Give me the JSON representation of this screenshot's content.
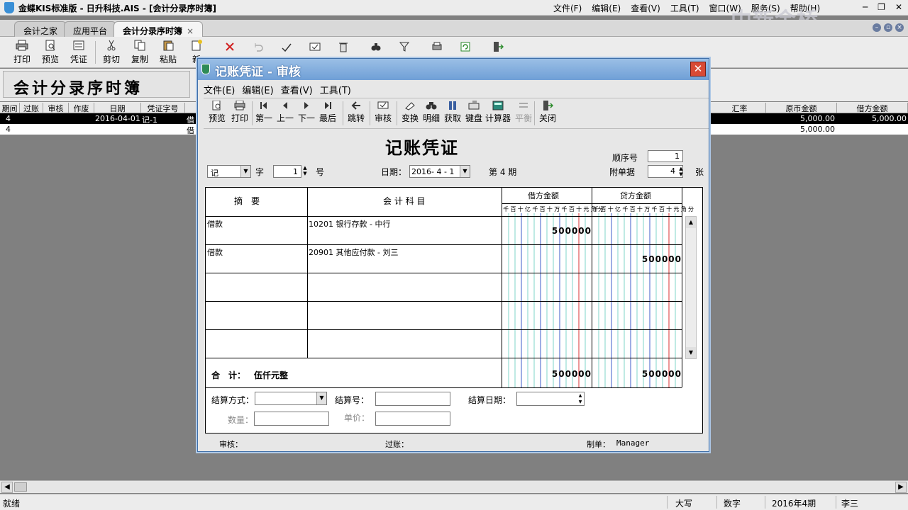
{
  "app": {
    "title": "金蝶KIS标准版 - 日升科技.AIS - [会计分录序时簿]",
    "menu": [
      "文件(F)",
      "编辑(E)",
      "查看(V)",
      "工具(T)",
      "窗口(W)",
      "服务(S)",
      "帮助(H)"
    ],
    "watermark": "中新金桥",
    "win_min": "─",
    "win_restore": "❐",
    "win_close": "✕"
  },
  "tabs": [
    {
      "label": "会计之家"
    },
    {
      "label": "应用平台"
    },
    {
      "label": "会计分录序时簿",
      "close": "×"
    }
  ],
  "toolbar": {
    "print": "打印",
    "preview": "预览",
    "voucher": "凭证",
    "cut": "剪切",
    "copy": "复制",
    "paste": "粘贴",
    "new": "新"
  },
  "page_title": "会计分录序时簿",
  "grid": {
    "headers": [
      "期间",
      "过账",
      "审核",
      "作废",
      "日期",
      "凭证字号",
      "",
      "汇率",
      "原币金额",
      "借方金额"
    ],
    "rows": [
      {
        "period": "4",
        "date": "2016-04-01",
        "voucher_no": "记-1",
        "summary": "借",
        "original": "5,000.00",
        "debit": "5,000.00"
      },
      {
        "period": "4",
        "summary": "借",
        "original": "5,000.00",
        "debit": ""
      }
    ]
  },
  "statusbar": {
    "ready": "就绪",
    "caps": "大写",
    "num": "数字",
    "period": "2016年4期",
    "user": "李三"
  },
  "dialog": {
    "title": "记账凭证 - 审核",
    "close": "✕",
    "menu": [
      "文件(E)",
      "编辑(E)",
      "查看(V)",
      "工具(T)"
    ],
    "toolbar": {
      "preview": "预览",
      "print": "打印",
      "first": "第一",
      "prev": "上一",
      "next": "下一",
      "last": "最后",
      "jump": "跳转",
      "audit": "审核",
      "transform": "变换",
      "detail": "明细",
      "fetch": "获取",
      "keyboard": "键盘",
      "calculator": "计算器",
      "balance": "平衡",
      "close": "关闭"
    },
    "voucher_title": "记账凭证",
    "seq_label": "顺序号",
    "seq_value": "1",
    "attach_label": "附单据",
    "attach_value": "4",
    "attach_unit": "张",
    "word_value": "记",
    "word_label": "字",
    "number_value": "1",
    "number_label": "号",
    "date_label": "日期：",
    "date_value": "2016- 4 - 1",
    "period_text": "第 4 期",
    "table": {
      "summary_header": "摘　要",
      "account_header": "会 计 科 目",
      "debit_header": "借方金额",
      "credit_header": "贷方金额",
      "digits": [
        "千",
        "百",
        "十",
        "亿",
        "千",
        "百",
        "十",
        "万",
        "千",
        "百",
        "十",
        "元",
        "角",
        "分"
      ],
      "entries": [
        {
          "summary": "借款",
          "account": "10201 银行存款 - 中行",
          "debit": "500000",
          "credit": ""
        },
        {
          "summary": "借款",
          "account": "20901 其他应付款 - 刘三",
          "debit": "",
          "credit": "500000"
        }
      ],
      "total_label": "合　计：",
      "total_words": "伍仟元整",
      "total_debit": "500000",
      "total_credit": "500000"
    },
    "settle_method_label": "结算方式：",
    "settle_no_label": "结算号：",
    "settle_date_label": "结算日期：",
    "qty_label": "数量：",
    "price_label": "单价：",
    "auditor_label": "审核：",
    "posting_label": "过账：",
    "maker_label": "制单：",
    "maker_value": "Manager"
  },
  "colors": {
    "dialog_title": "#6f9fd6",
    "close_btn": "#d84a35",
    "selected_row": "#000000"
  }
}
